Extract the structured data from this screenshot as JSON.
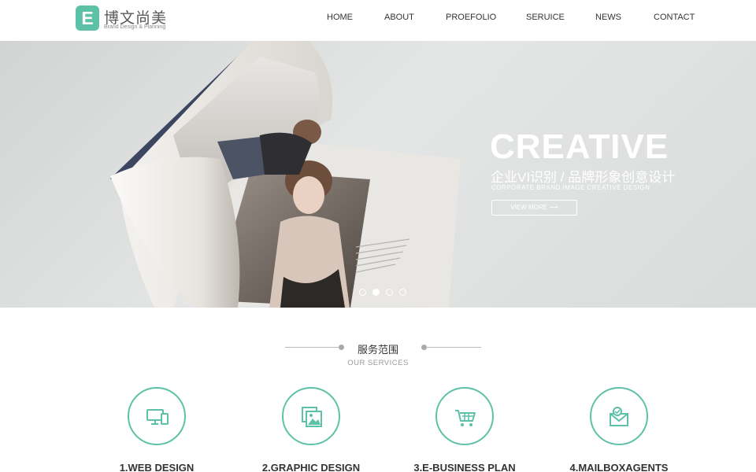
{
  "brand": {
    "letter": "E",
    "name_cn": "博文尚美",
    "tagline": "Brand Design & Planning",
    "accent_color": "#5cc1a7"
  },
  "nav": {
    "items": [
      {
        "label": "HOME"
      },
      {
        "label": "ABOUT"
      },
      {
        "label": "PROEFOLIO"
      },
      {
        "label": "SERUICE"
      },
      {
        "label": "NEWS"
      },
      {
        "label": "CONTACT"
      }
    ]
  },
  "banner": {
    "title": "CREATIVE",
    "subtitle_cn": "企业VI识别 / 品牌形象创意设计",
    "subtitle_en": "CORPORATE BRAND IMAGE CREATIVE DESIGN",
    "button_label": "VIEW MORE ⟶",
    "slide_count": 4,
    "active_slide": 2
  },
  "services": {
    "title_cn": "服务范围",
    "title_en": "OUR SERVICES",
    "items": [
      {
        "label": "1.WEB DESIGN",
        "icon": "devices-icon"
      },
      {
        "label": "2.GRAPHIC DESIGN",
        "icon": "image-gallery-icon"
      },
      {
        "label": "3.E-BUSINESS PLAN",
        "icon": "shopping-cart-icon"
      },
      {
        "label": "4.MAILBOXAGENTS",
        "icon": "mail-icon"
      }
    ]
  }
}
